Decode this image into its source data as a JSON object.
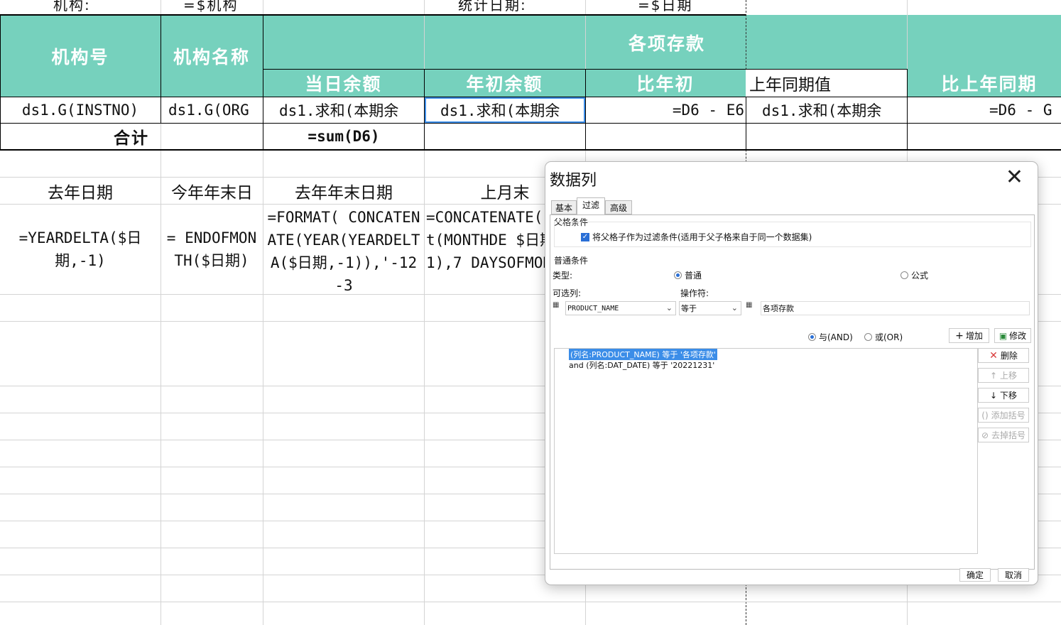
{
  "sheet": {
    "top_row": {
      "org_label": "机构:",
      "org_value": "=$机构",
      "date_label": "统计日期:",
      "date_value": "=$日期"
    },
    "header": {
      "inst_no": "机构号",
      "inst_name": "机构名称",
      "deposits": "各项存款",
      "today_balance": "当日余额",
      "year_start_balance": "年初余额",
      "vs_year_start": "比年初",
      "last_year_same": "上年同期值",
      "vs_last_year": "比上年同期"
    },
    "data_row": {
      "c1": "ds1.G(INSTNO)",
      "c2": "ds1.G(ORG",
      "c3": "ds1.求和(本期余",
      "c4": "ds1.求和(本期余",
      "c5": "=D6 - E6",
      "c6": "ds1.求和(本期余",
      "c7": "=D6 - G"
    },
    "total_row": {
      "label": "合计",
      "sum": "=sum(D6)"
    },
    "param_header": {
      "c1": "去年日期",
      "c2": "今年年末日",
      "c3": "去年年末日期",
      "c4": "上月末"
    },
    "param_row": {
      "c1": "=YEARDELTA($日期,-1)",
      "c2": "= ENDOFMONTH($日期)",
      "c3": "=FORMAT( CONCATENATE(YEAR(YEARDELTA($日期,-1)),'-12-3",
      "c4": "=CONCATENATE( left(MONTHDE $日期,-1),7 DAYSOFMONT"
    }
  },
  "dialog": {
    "title": "数据列",
    "tabs": [
      "基本",
      "过滤",
      "高级"
    ],
    "active_tab": "过滤",
    "parent_section": "父格条件",
    "parent_checkbox": "将父格子作为过滤条件(适用于父子格来自于同一个数据集)",
    "normal_section": "普通条件",
    "type_label": "类型:",
    "type_normal": "普通",
    "type_formula": "公式",
    "column_label": "可选列:",
    "operator_label": "操作符:",
    "column_value": "PRODUCT_NAME",
    "operator_value": "等于",
    "value_text": "各项存款",
    "and_label": "与(AND)",
    "or_label": "或(OR)",
    "add_button": "增加",
    "modify_button": "修改",
    "delete_button": "删除",
    "up_button": "上移",
    "down_button": "下移",
    "add_bracket_button": "添加括号",
    "remove_bracket_button": "去掉括号",
    "conditions": [
      "(列名:PRODUCT_NAME) 等于 '各项存款'",
      "and (列名:DAT_DATE) 等于 '20221231'"
    ],
    "ok_button": "确定",
    "cancel_button": "取消",
    "colors": {
      "header_teal": "#76d1bd",
      "selection_blue": "#3b8de8",
      "delete_red": "#d93b3b"
    }
  }
}
